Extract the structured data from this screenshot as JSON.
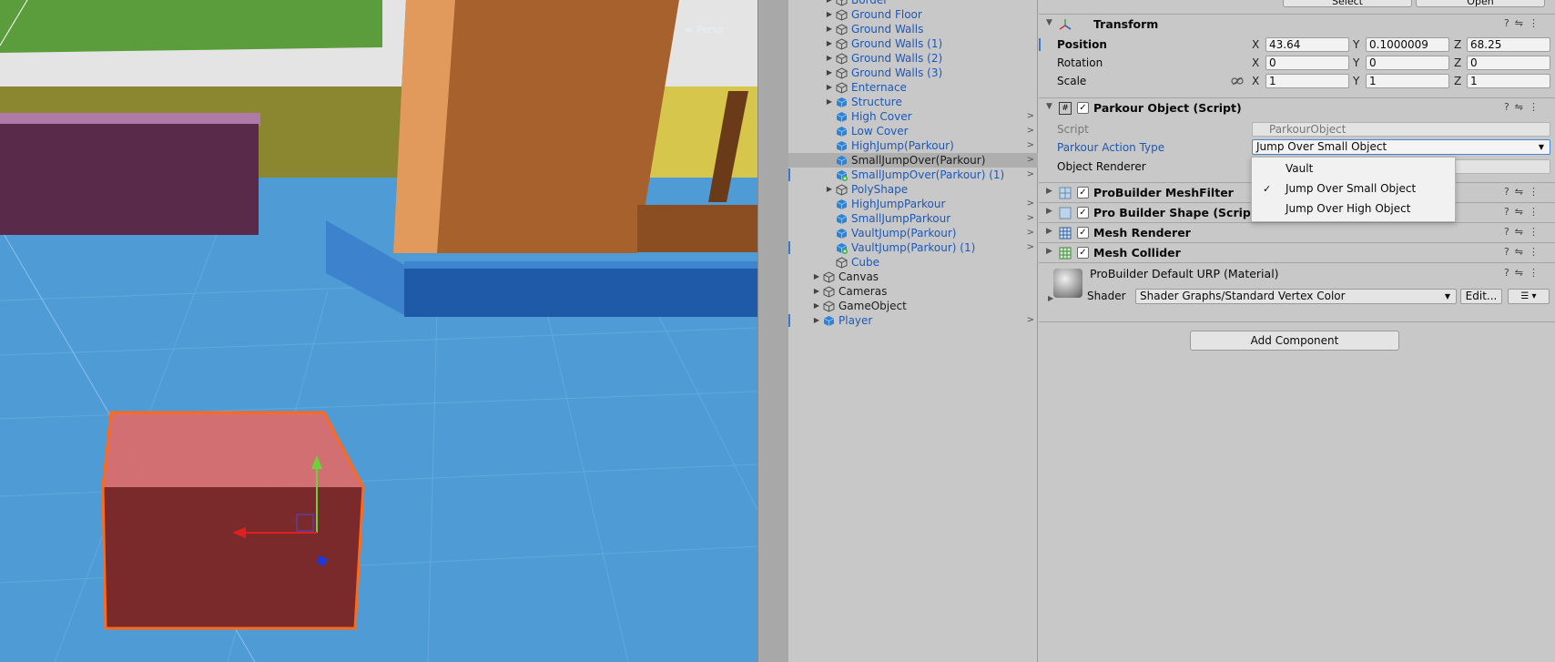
{
  "scene": {
    "persp_label": "< Persp",
    "colors": {
      "ground": "#4f9bd6",
      "selected_cube": "#7a2a2a",
      "selection_outline": "#ff6a1a"
    }
  },
  "hierarchy": {
    "items": [
      {
        "label": "Border",
        "icon": "cube-outline-icon",
        "kind": "prefab",
        "expandable": true
      },
      {
        "label": "Ground Floor",
        "icon": "cube-outline-icon",
        "kind": "prefab",
        "expandable": true
      },
      {
        "label": "Ground Walls",
        "icon": "cube-outline-icon",
        "kind": "prefab",
        "expandable": true
      },
      {
        "label": "Ground Walls (1)",
        "icon": "cube-outline-icon",
        "kind": "prefab",
        "expandable": true
      },
      {
        "label": "Ground Walls (2)",
        "icon": "cube-outline-icon",
        "kind": "prefab",
        "expandable": true
      },
      {
        "label": "Ground Walls (3)",
        "icon": "cube-outline-icon",
        "kind": "prefab",
        "expandable": true
      },
      {
        "label": "Enternace",
        "icon": "cube-outline-icon",
        "kind": "prefab",
        "expandable": true
      },
      {
        "label": "Structure",
        "icon": "prefab-cube-icon",
        "kind": "prefab",
        "expandable": true
      },
      {
        "label": "High Cover",
        "icon": "prefab-cube-icon",
        "kind": "prefab",
        "arrow": true
      },
      {
        "label": "Low Cover",
        "icon": "prefab-cube-icon",
        "kind": "prefab",
        "arrow": true
      },
      {
        "label": "HighJump(Parkour)",
        "icon": "prefab-cube-icon",
        "kind": "prefab",
        "arrow": true
      },
      {
        "label": "SmallJumpOver(Parkour)",
        "icon": "prefab-cube-icon",
        "kind": "selected",
        "arrow": true
      },
      {
        "label": "SmallJumpOver(Parkour) (1)",
        "icon": "prefab-cube-added-icon",
        "kind": "prefab",
        "arrow": true,
        "mark": true
      },
      {
        "label": "PolyShape",
        "icon": "cube-outline-icon",
        "kind": "prefab",
        "expandable": true
      },
      {
        "label": "HighJumpParkour",
        "icon": "prefab-cube-icon",
        "kind": "prefab",
        "arrow": true
      },
      {
        "label": "SmallJumpParkour",
        "icon": "prefab-cube-icon",
        "kind": "prefab",
        "arrow": true
      },
      {
        "label": "VaultJump(Parkour)",
        "icon": "prefab-cube-icon",
        "kind": "prefab",
        "arrow": true
      },
      {
        "label": "VaultJump(Parkour) (1)",
        "icon": "prefab-cube-added-icon",
        "kind": "prefab",
        "arrow": true,
        "mark": true
      },
      {
        "label": "Cube",
        "icon": "cube-outline-icon",
        "kind": "prefab"
      },
      {
        "label": "Canvas",
        "icon": "cube-outline-icon",
        "kind": "plain",
        "expandable": true,
        "root": true
      },
      {
        "label": "Cameras",
        "icon": "cube-outline-icon",
        "kind": "plain",
        "expandable": true,
        "root": true
      },
      {
        "label": "GameObject",
        "icon": "cube-outline-icon",
        "kind": "plain",
        "expandable": true,
        "root": true
      },
      {
        "label": "Player",
        "icon": "prefab-cube-icon",
        "kind": "prefab",
        "expandable": true,
        "root": true,
        "arrow": true,
        "mark": true
      }
    ]
  },
  "inspector": {
    "top_buttons": {
      "select": "Select",
      "open": "Open"
    },
    "transform": {
      "title": "Transform",
      "position": {
        "label": "Position",
        "x": "43.64",
        "y": "0.1000009",
        "z": "68.25"
      },
      "rotation": {
        "label": "Rotation",
        "x": "0",
        "y": "0",
        "z": "0"
      },
      "scale": {
        "label": "Scale",
        "x": "1",
        "y": "1",
        "z": "1"
      },
      "axis": {
        "x": "X",
        "y": "Y",
        "z": "Z"
      }
    },
    "parkour_object": {
      "title": "Parkour Object (Script)",
      "script_label": "Script",
      "script_value": "ParkourObject",
      "action_label": "Parkour Action Type",
      "action_value": "Jump Over Small Object",
      "renderer_label": "Object Renderer"
    },
    "dropdown_menu": {
      "options": [
        {
          "label": "Vault",
          "checked": false
        },
        {
          "label": "Jump Over Small Object",
          "checked": true
        },
        {
          "label": "Jump Over High Object",
          "checked": false
        }
      ],
      "check_glyph": "✓"
    },
    "components": [
      {
        "title": "ProBuilder MeshFilter",
        "icon": "mesh-filter-icon"
      },
      {
        "title": "Pro Builder Shape (Script)",
        "icon": "script-icon"
      },
      {
        "title": "Mesh Renderer",
        "icon": "mesh-renderer-icon"
      },
      {
        "title": "Mesh Collider",
        "icon": "mesh-collider-icon"
      }
    ],
    "material": {
      "title": "ProBuilder Default URP (Material)",
      "shader_label": "Shader",
      "shader_value": "Shader Graphs/Standard Vertex Color",
      "edit_label": "Edit..."
    },
    "add_component": "Add Component"
  }
}
